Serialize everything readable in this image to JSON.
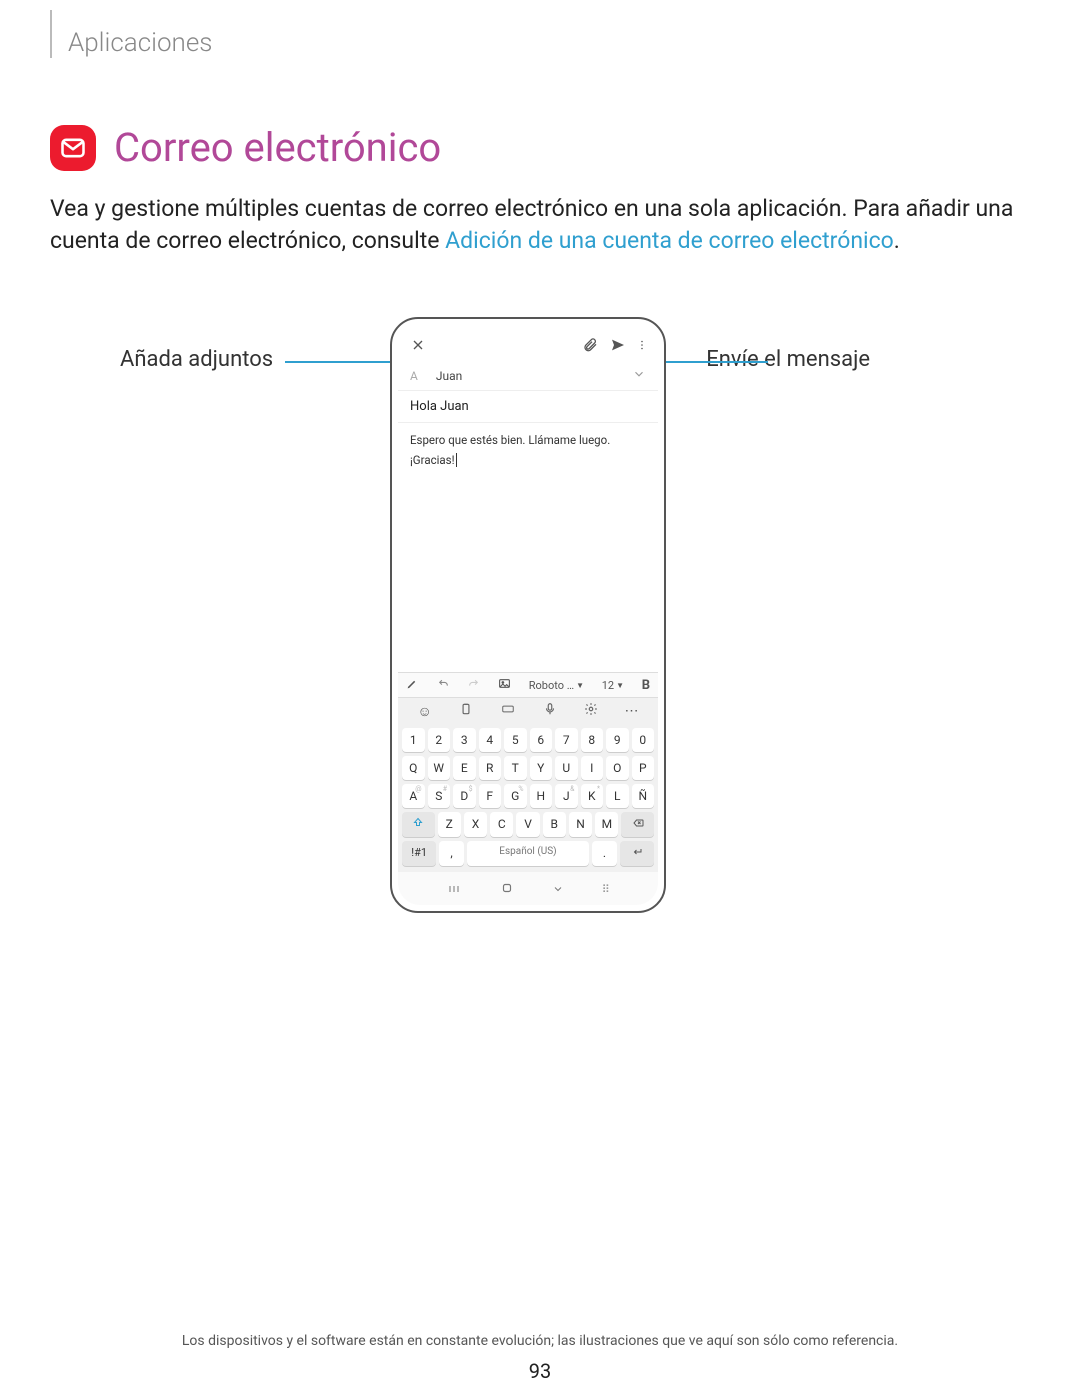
{
  "breadcrumb": "Aplicaciones",
  "title": "Correo electrónico",
  "intro_before": "Vea y gestione múltiples cuentas de correo electrónico en una sola aplicación. Para añadir una cuenta de correo electrónico, consulte ",
  "intro_link": "Adición de una cuenta de correo electrónico",
  "intro_after": ".",
  "callouts": {
    "attach": "Añada adjuntos",
    "send": "Envíe el mensaje"
  },
  "compose": {
    "to_label": "A",
    "to_name": "Juan",
    "subject": "Hola Juan",
    "body_line1": "Espero que estés bien. Llámame luego.",
    "body_line2": "¡Gracias!"
  },
  "format_bar": {
    "font": "Roboto …",
    "size": "12",
    "bold": "B"
  },
  "keyboard": {
    "row_num": [
      "1",
      "2",
      "3",
      "4",
      "5",
      "6",
      "7",
      "8",
      "9",
      "0"
    ],
    "row1": [
      "Q",
      "W",
      "E",
      "R",
      "T",
      "Y",
      "U",
      "I",
      "O",
      "P"
    ],
    "row2": [
      "A",
      "S",
      "D",
      "F",
      "G",
      "H",
      "J",
      "K",
      "L",
      "Ñ"
    ],
    "row3": [
      "Z",
      "X",
      "C",
      "V",
      "B",
      "N",
      "M"
    ],
    "sym": "!#1",
    "comma": ",",
    "space": "Español (US)",
    "period": "."
  },
  "footnote": "Los dispositivos y el software están en constante evolución; las ilustraciones que ve aquí son sólo como referencia.",
  "page_number": "93"
}
